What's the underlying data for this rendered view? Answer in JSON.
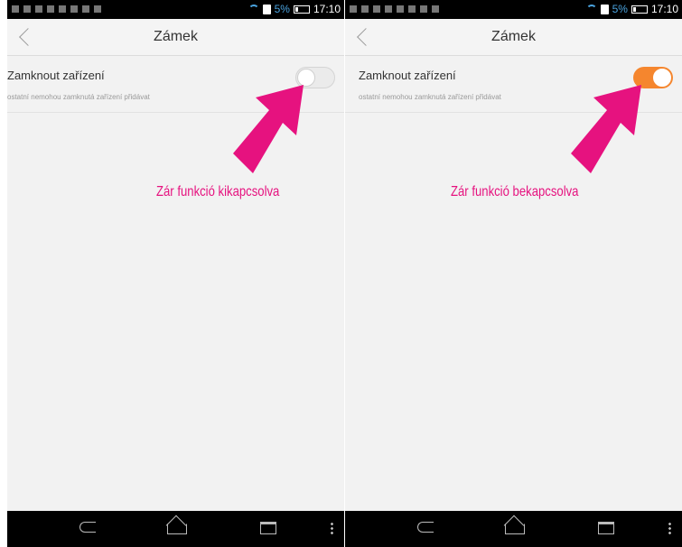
{
  "status_bar": {
    "battery": "5%",
    "time": "17:10"
  },
  "screens": [
    {
      "title": "Zámek",
      "setting_label": "Zamknout zařízení",
      "setting_desc": "ostatní nemohou zamknutá zařízení přidávat",
      "toggle_state": "off",
      "caption": "Zár funkció kikapcsolva"
    },
    {
      "title": "Zámek",
      "setting_label": "Zamknout zařízení",
      "setting_desc": "ostatní nemohou zamknutá zařízení přidávat",
      "toggle_state": "on",
      "caption": "Zár funkció bekapcsolva"
    }
  ],
  "colors": {
    "toggle_on": "#f5862e",
    "annotation": "#e6127f"
  },
  "icons": [
    "back-chevron-icon",
    "wifi-icon",
    "battery-icon",
    "nav-back-icon",
    "nav-home-icon",
    "nav-recent-icon",
    "nav-menu-icon",
    "pointer-arrow-icon"
  ]
}
